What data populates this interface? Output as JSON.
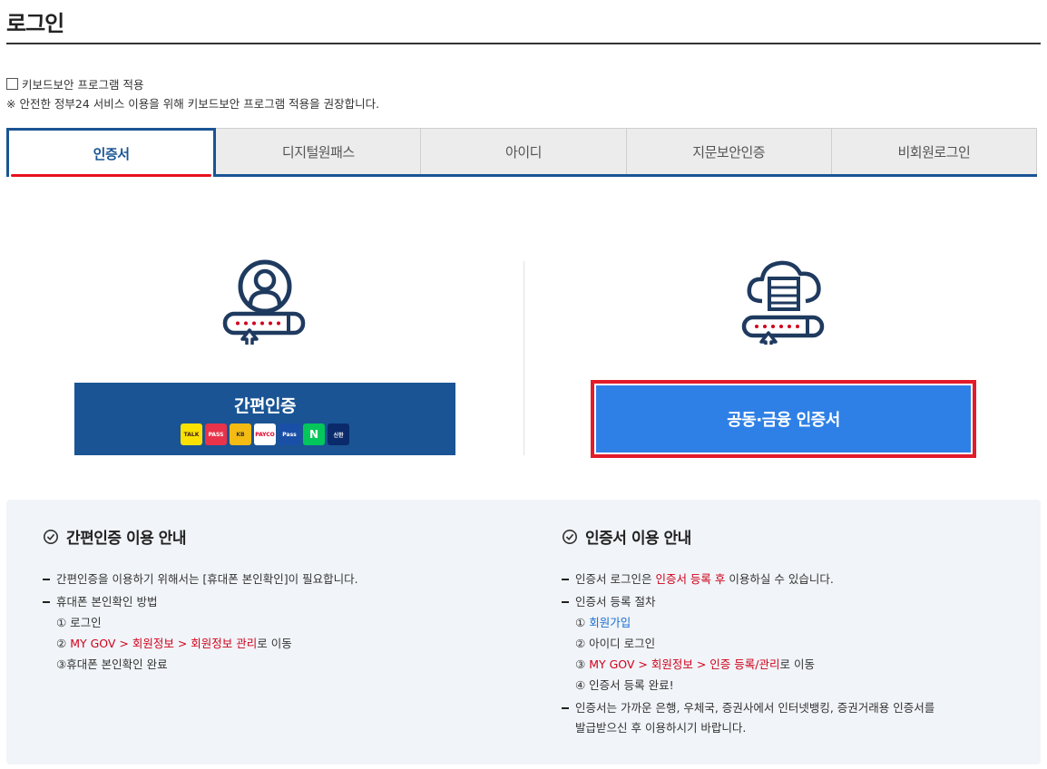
{
  "page": {
    "title": "로그인"
  },
  "keyboard_security": {
    "checkbox_label": "키보드보안 프로그램 적용",
    "note": "※ 안전한 정부24 서비스 이용을 위해 키보드보안 프로그램 적용을 권장합니다."
  },
  "tabs": [
    {
      "label": "인증서",
      "active": true
    },
    {
      "label": "디지털원패스",
      "active": false
    },
    {
      "label": "아이디",
      "active": false
    },
    {
      "label": "지문보안인증",
      "active": false
    },
    {
      "label": "비회원로그인",
      "active": false
    }
  ],
  "simple_auth": {
    "button_label": "간편인증",
    "logos": [
      "TALK",
      "PASS",
      "KB",
      "PAYCO",
      "Pass",
      "N",
      "신한"
    ]
  },
  "cert_auth": {
    "button_label": "공동·금융 인증서"
  },
  "info_simple": {
    "heading": "간편인증 이용 안내",
    "item1": "간편인증을 이용하기 위해서는 [휴대폰 본인확인]이 필요합니다.",
    "item2": "휴대폰 본인확인 방법",
    "step1": "① 로그인",
    "step2_prefix": "② ",
    "step2_red": "MY GOV > 회원정보 > 회원정보 관리",
    "step2_suffix": "로 이동",
    "step3": "③휴대폰 본인확인 완료"
  },
  "info_cert": {
    "heading": "인증서 이용 안내",
    "item1_a": "인증서 로그인은 ",
    "item1_red": "인증서 등록 후",
    "item1_b": " 이용하실 수 있습니다.",
    "item2": "인증서 등록 절차",
    "step1_prefix": "① ",
    "step1_blue": "회원가입",
    "step2": "② 아이디 로그인",
    "step3_prefix": "③ ",
    "step3_red": "MY GOV > 회원정보 > 인증 등록/관리",
    "step3_suffix": "로 이동",
    "step4": "④ 인증서 등록 완료!",
    "item3_line1": "인증서는 가까운 은행, 우체국, 증권사에서 인터넷뱅킹, 증권거래용 인증서를",
    "item3_line2": "발급받으신 후 이용하시기 바랍니다."
  },
  "colors": {
    "navy": "#1a5494",
    "accent_red": "#e31b2a",
    "cert_blue": "#2f80e6",
    "info_bg": "#f1f4f8"
  }
}
